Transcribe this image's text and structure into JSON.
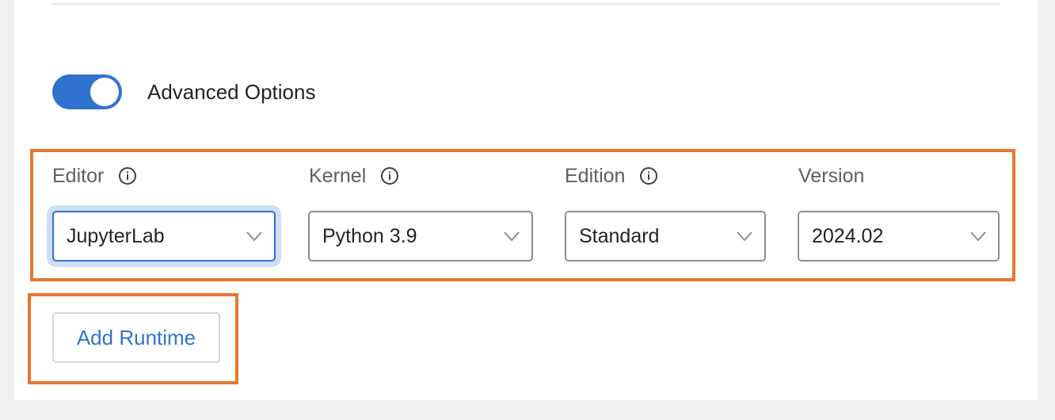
{
  "advanced": {
    "label": "Advanced Options",
    "enabled": true
  },
  "fields": {
    "editor": {
      "label": "Editor",
      "value": "JupyterLab"
    },
    "kernel": {
      "label": "Kernel",
      "value": "Python 3.9"
    },
    "edition": {
      "label": "Edition",
      "value": "Standard"
    },
    "version": {
      "label": "Version",
      "value": "2024.02"
    }
  },
  "actions": {
    "add_runtime": "Add Runtime"
  },
  "colors": {
    "accent": "#2f72d0",
    "highlight": "#e8762f"
  }
}
